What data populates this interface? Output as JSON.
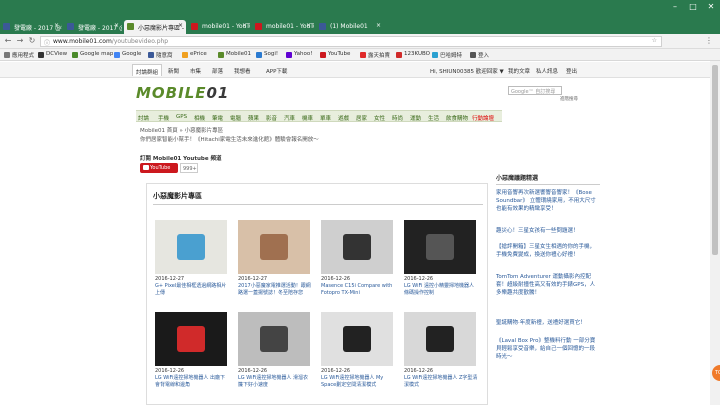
{
  "browser": {
    "tabs": [
      {
        "label": "發電廠 - 2017 @發電廠- 2017",
        "active": false,
        "color": "#3b5998"
      },
      {
        "label": "發電廠 - 2017 @發電廠- 2017",
        "active": false,
        "color": "#3b5998"
      },
      {
        "label": "小惡魔影片專區 - Mobile01",
        "active": true,
        "color": "#5a8a2a"
      },
      {
        "label": "mobile01 - YouTube",
        "active": false,
        "color": "#cc181e"
      },
      {
        "label": "mobile01 - YouTube",
        "active": false,
        "color": "#cc181e"
      },
      {
        "label": "(1) Mobile01",
        "active": false,
        "color": "#3b5998"
      }
    ],
    "url_host": "www.mobile01.com",
    "url_path": "/youtubevideo.php",
    "lock_icon": "info-icon",
    "back_icon": "←",
    "forward_icon": "→",
    "reload_icon": "↻",
    "star_icon": "☆",
    "menu_icon": "⋮",
    "win_min": "–",
    "win_max": "□",
    "win_close": "✕",
    "bookmarks": [
      {
        "label": "應用程式",
        "color": "#777"
      },
      {
        "label": "DCView",
        "color": "#333"
      },
      {
        "label": "Google map",
        "color": "#4a8a2a"
      },
      {
        "label": "Google",
        "color": "#4285f4"
      },
      {
        "label": "隨意窩",
        "color": "#3b5998"
      },
      {
        "label": "ePrice",
        "color": "#f0a020"
      },
      {
        "label": "Mobile01",
        "color": "#5a8a2a"
      },
      {
        "label": "Sogi!",
        "color": "#2a7ad0"
      },
      {
        "label": "Yahoo!",
        "color": "#6001d2"
      },
      {
        "label": "YouTube",
        "color": "#cc181e"
      },
      {
        "label": "露天拍賣",
        "color": "#e02a2a"
      },
      {
        "label": "123KUBO",
        "color": "#d02a2a"
      },
      {
        "label": "巴哈姆特",
        "color": "#2aa0d0"
      },
      {
        "label": "登入",
        "color": "#555"
      }
    ]
  },
  "site": {
    "topnav": [
      "討論群組",
      "新聞",
      "市集",
      "部落",
      "我想看",
      "APP下載"
    ],
    "userbar": [
      "Hi, SHIUN00385 歡迎回家 ▼",
      "我的文章",
      "私人訊息",
      "登出"
    ],
    "logo": {
      "a": "MOBILE",
      "b": "01"
    },
    "search_placeholder": "Google™ 自訂搜尋",
    "advanced_search": "進階搜尋",
    "categories": [
      "討論",
      "手機",
      "GPS",
      "相機",
      "筆電",
      "電腦",
      "蘋果",
      "影音",
      "汽車",
      "機車",
      "單車",
      "遊戲",
      "居家",
      "女性",
      "時尚",
      "運動",
      "生活",
      "飲食購物",
      "行動論壇"
    ],
    "breadcrumb": "Mobile01 首頁 » 小惡魔影片專區",
    "notice": "你們居家智能小幫手！《Hitachi家電生活未來進化館》體驗會報名開放～",
    "subscribe_title": "訂閱 Mobile01 Youtube 頻道",
    "youtube_label": "YouTube",
    "youtube_count": "999+"
  },
  "panel": {
    "title": "小惡魔影片專區",
    "videos": [
      {
        "date": "2016-12-27",
        "title": "G+ Pixel最佳相框透過網路相片上傳",
        "bg": "#e6e6e0",
        "fg": "#4aa0d0"
      },
      {
        "date": "2016-12-27",
        "title": "2017小惡魔家電推選活動！跟網路選一蓋揚號誌！冬至陪存您",
        "bg": "#d8c0a8",
        "fg": "#a07050"
      },
      {
        "date": "2016-12-26",
        "title": "Masence C15i Compare with Fotopro TX-Mini",
        "bg": "#cfcfcf",
        "fg": "#333333"
      },
      {
        "date": "2016-12-26",
        "title": "LG WiFi 遠控小精靈掃地機器人條碼操作控制",
        "bg": "#222222",
        "fg": "#555555"
      },
      {
        "date": "2016-12-26",
        "title": "LG WiFi遠控掃地機器人 出廠下會背電線和邊角",
        "bg": "#1a1a1a",
        "fg": "#d02a2a"
      },
      {
        "date": "2016-12-26",
        "title": "LG WiFi遠控掃地機器人 滑溜衣簾下好小速度",
        "bg": "#bdbdbd",
        "fg": "#444444"
      },
      {
        "date": "2016-12-26",
        "title": "LG WiFi遠控掃地機器人 My Space劃定空間清潔模式",
        "bg": "#e0e0e0",
        "fg": "#222222"
      },
      {
        "date": "2016-12-26",
        "title": "LG WiFi遠控掃地機器人 Z字型清潔模式",
        "bg": "#d8d8d8",
        "fg": "#222222"
      }
    ]
  },
  "sidebar": {
    "title": "小惡魔議題精選",
    "items": [
      "家用音響再次新選響響音響家！《Bose Soundbar》 立體環繞家用，不用大尺寸也能有效果的精緻享受！",
      "趣災心！三星女孩有一些問題選！",
      "【搶評開箱】三星女生相遇的你的手機，手機免費變成，換送你禮心好禮！",
      "TomTom Adventurer 運動攝影內控配套！超級耐撞性高又有效的手錶GPS，人多樂趣共度歡騰！",
      "聖誕購物‧年度新禮，送禮好選買它！",
      "《Laval Box Pro》整機料行動 一部分寶貝輕鬆享受音樂，給自己一個回憶的一段時光～"
    ]
  },
  "float_button": "TOP"
}
